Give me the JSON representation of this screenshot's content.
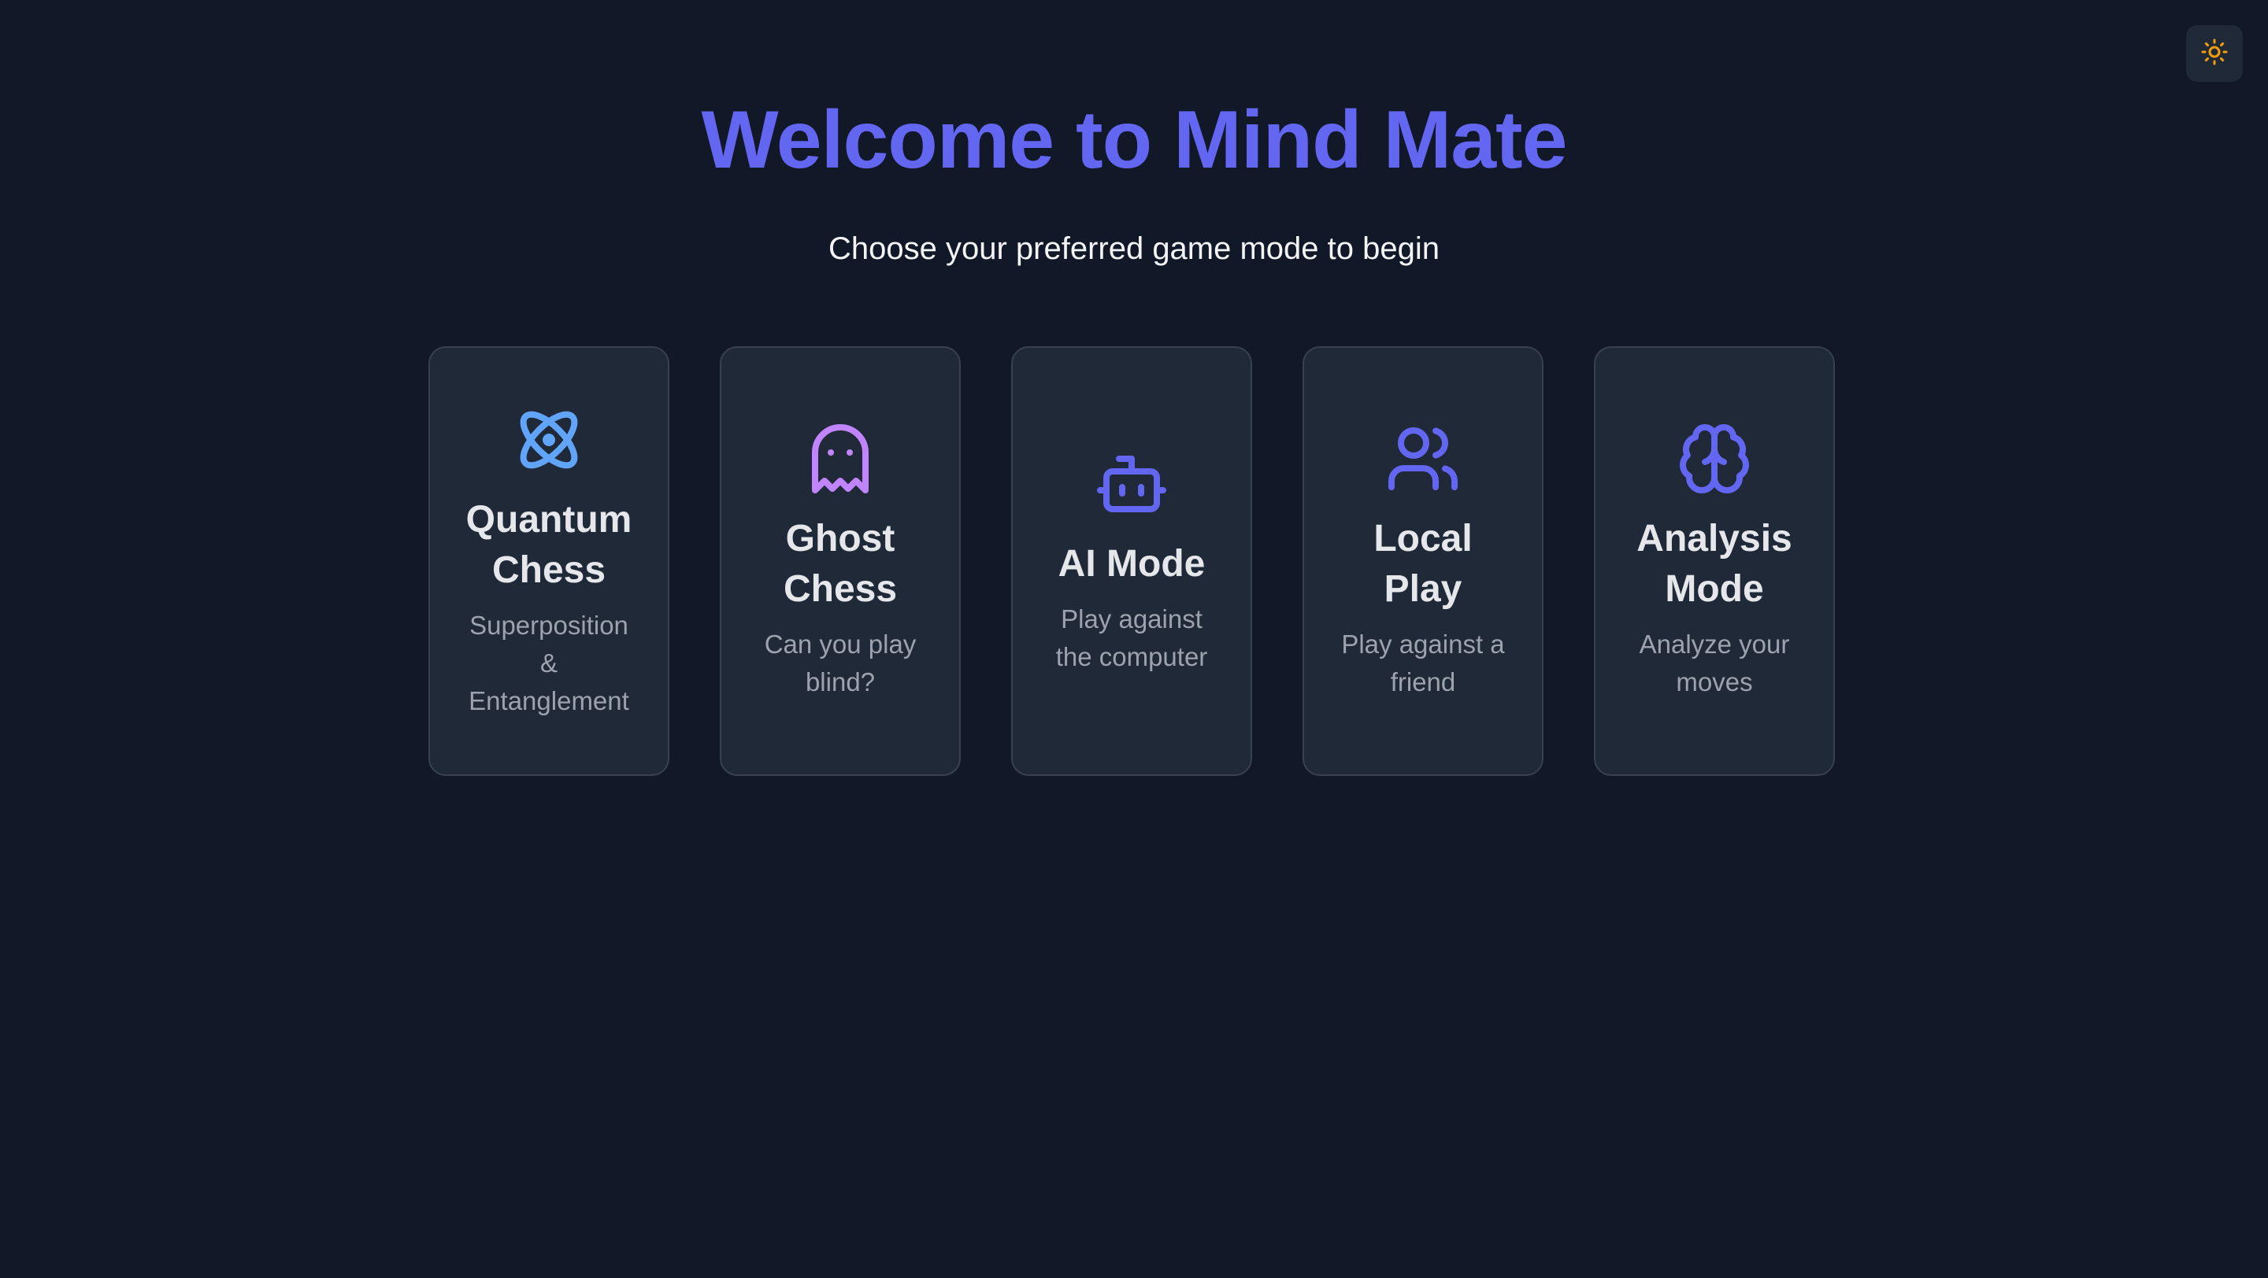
{
  "header": {
    "title": "Welcome to Mind Mate",
    "subtitle": "Choose your preferred game mode to begin"
  },
  "theme_toggle": {
    "icon": "sun-icon",
    "color": "#f59e0b"
  },
  "modes": [
    {
      "title": "Quantum Chess",
      "description": "Superposition & Entanglement",
      "icon": "atom-icon",
      "color": "#60a5fa"
    },
    {
      "title": "Ghost Chess",
      "description": "Can you play blind?",
      "icon": "ghost-icon",
      "color": "#c084fc"
    },
    {
      "title": "AI Mode",
      "description": "Play against the computer",
      "icon": "robot-icon",
      "color": "#6366f1"
    },
    {
      "title": "Local Play",
      "description": "Play against a friend",
      "icon": "users-icon",
      "color": "#6366f1"
    },
    {
      "title": "Analysis Mode",
      "description": "Analyze your moves",
      "icon": "brain-icon",
      "color": "#6366f1"
    }
  ],
  "colors": {
    "background": "#111827",
    "card": "#1f2937",
    "accent": "#6366f1"
  }
}
